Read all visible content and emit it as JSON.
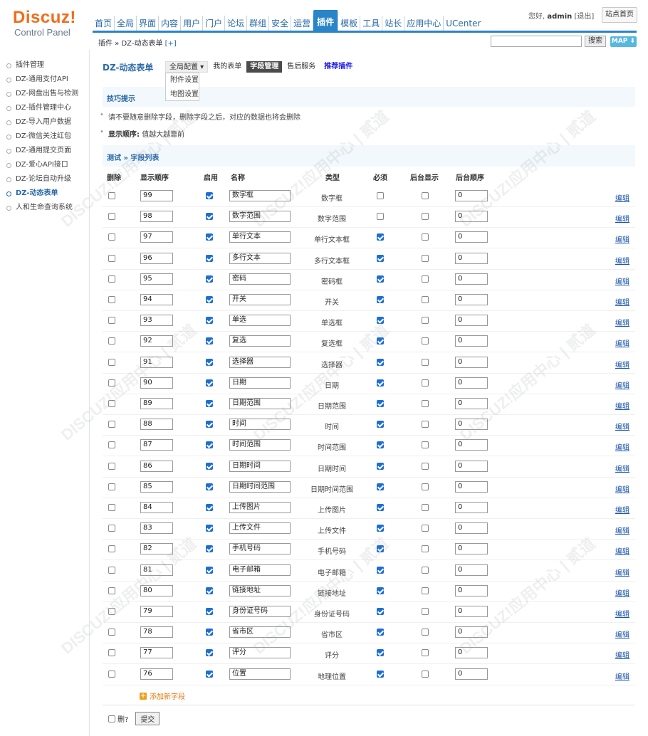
{
  "logo": {
    "main": "Discuz!",
    "sub": "Control Panel"
  },
  "topnav": [
    "首页",
    "全局",
    "界面",
    "内容",
    "用户",
    "门户",
    "论坛",
    "群组",
    "安全",
    "运营",
    "插件",
    "模板",
    "工具",
    "站长",
    "应用中心",
    "UCenter"
  ],
  "topnav_active": "插件",
  "user": {
    "greeting": "您好,",
    "name": "admin",
    "logout": "[退出]",
    "home": "站点首页"
  },
  "breadcrumb": {
    "path": "插件 » DZ-动态表单",
    "add": "[+]"
  },
  "search": {
    "button": "搜索",
    "map": "MAP ⬇"
  },
  "sidebar": [
    "插件管理",
    "DZ-通用支付API",
    "DZ-网盘出售与检测",
    "DZ-插件管理中心",
    "DZ-导入用户数据",
    "DZ-微信关注红包",
    "DZ-通用提交页面",
    "DZ-爱心API接口",
    "DZ-论坛自动升级",
    "DZ-动态表单",
    "人和生命查询系统"
  ],
  "sidebar_active": "DZ-动态表单",
  "page": {
    "title": "DZ-动态表单",
    "subnav": {
      "global": "全局配置 ▾",
      "mine": "我的表单",
      "fields": "字段管理",
      "after": "售后服务",
      "recommend": "推荐插件"
    },
    "dropdown": [
      "附件设置",
      "地图设置"
    ],
    "tips_title": "技巧提示",
    "tip1": "请不要随意删除字段，删除字段之后，对应的数据也将会删除",
    "tip2_label": "显示顺序:",
    "tip2_text": "值越大越靠前",
    "list_title": "测试 » 字段列表"
  },
  "columns": {
    "del": "删除",
    "order": "显示顺序",
    "enabled": "启用",
    "name": "名称",
    "type": "类型",
    "required": "必须",
    "backend_show": "后台显示",
    "backend_order": "后台顺序"
  },
  "rows": [
    {
      "order": "99",
      "name": "数字框",
      "type": "数字框",
      "required": false,
      "bshow": false,
      "border": "0"
    },
    {
      "order": "98",
      "name": "数字范围",
      "type": "数字范围",
      "required": false,
      "bshow": false,
      "border": "0"
    },
    {
      "order": "97",
      "name": "单行文本",
      "type": "单行文本框",
      "required": true,
      "bshow": false,
      "border": "0"
    },
    {
      "order": "96",
      "name": "多行文本",
      "type": "多行文本框",
      "required": true,
      "bshow": false,
      "border": "0"
    },
    {
      "order": "95",
      "name": "密码",
      "type": "密码框",
      "required": true,
      "bshow": false,
      "border": "0"
    },
    {
      "order": "94",
      "name": "开关",
      "type": "开关",
      "required": true,
      "bshow": false,
      "border": "0"
    },
    {
      "order": "93",
      "name": "单选",
      "type": "单选框",
      "required": true,
      "bshow": false,
      "border": "0"
    },
    {
      "order": "92",
      "name": "复选",
      "type": "复选框",
      "required": true,
      "bshow": false,
      "border": "0"
    },
    {
      "order": "91",
      "name": "选择器",
      "type": "选择器",
      "required": true,
      "bshow": false,
      "border": "0"
    },
    {
      "order": "90",
      "name": "日期",
      "type": "日期",
      "required": true,
      "bshow": false,
      "border": "0"
    },
    {
      "order": "89",
      "name": "日期范围",
      "type": "日期范围",
      "required": true,
      "bshow": false,
      "border": "0"
    },
    {
      "order": "88",
      "name": "时间",
      "type": "时间",
      "required": true,
      "bshow": false,
      "border": "0"
    },
    {
      "order": "87",
      "name": "时间范围",
      "type": "时间范围",
      "required": true,
      "bshow": false,
      "border": "0"
    },
    {
      "order": "86",
      "name": "日期时间",
      "type": "日期时间",
      "required": true,
      "bshow": false,
      "border": "0"
    },
    {
      "order": "85",
      "name": "日期时间范围",
      "type": "日期时间范围",
      "required": true,
      "bshow": false,
      "border": "0"
    },
    {
      "order": "84",
      "name": "上传图片",
      "type": "上传图片",
      "required": true,
      "bshow": false,
      "border": "0"
    },
    {
      "order": "83",
      "name": "上传文件",
      "type": "上传文件",
      "required": true,
      "bshow": false,
      "border": "0"
    },
    {
      "order": "82",
      "name": "手机号码",
      "type": "手机号码",
      "required": true,
      "bshow": false,
      "border": "0"
    },
    {
      "order": "81",
      "name": "电子邮箱",
      "type": "电子邮箱",
      "required": true,
      "bshow": false,
      "border": "0"
    },
    {
      "order": "80",
      "name": "链接地址",
      "type": "链接地址",
      "required": true,
      "bshow": false,
      "border": "0"
    },
    {
      "order": "79",
      "name": "身份证号码",
      "type": "身份证号码",
      "required": true,
      "bshow": false,
      "border": "0"
    },
    {
      "order": "78",
      "name": "省市区",
      "type": "省市区",
      "required": true,
      "bshow": false,
      "border": "0"
    },
    {
      "order": "77",
      "name": "评分",
      "type": "评分",
      "required": true,
      "bshow": false,
      "border": "0"
    },
    {
      "order": "76",
      "name": "位置",
      "type": "地理位置",
      "required": true,
      "bshow": false,
      "border": "0"
    }
  ],
  "edit_label": "编辑",
  "add_field": "添加新字段",
  "delete_label": "删?",
  "submit": "提交",
  "watermark": "DISCUZ!应用中心 | 贰道"
}
